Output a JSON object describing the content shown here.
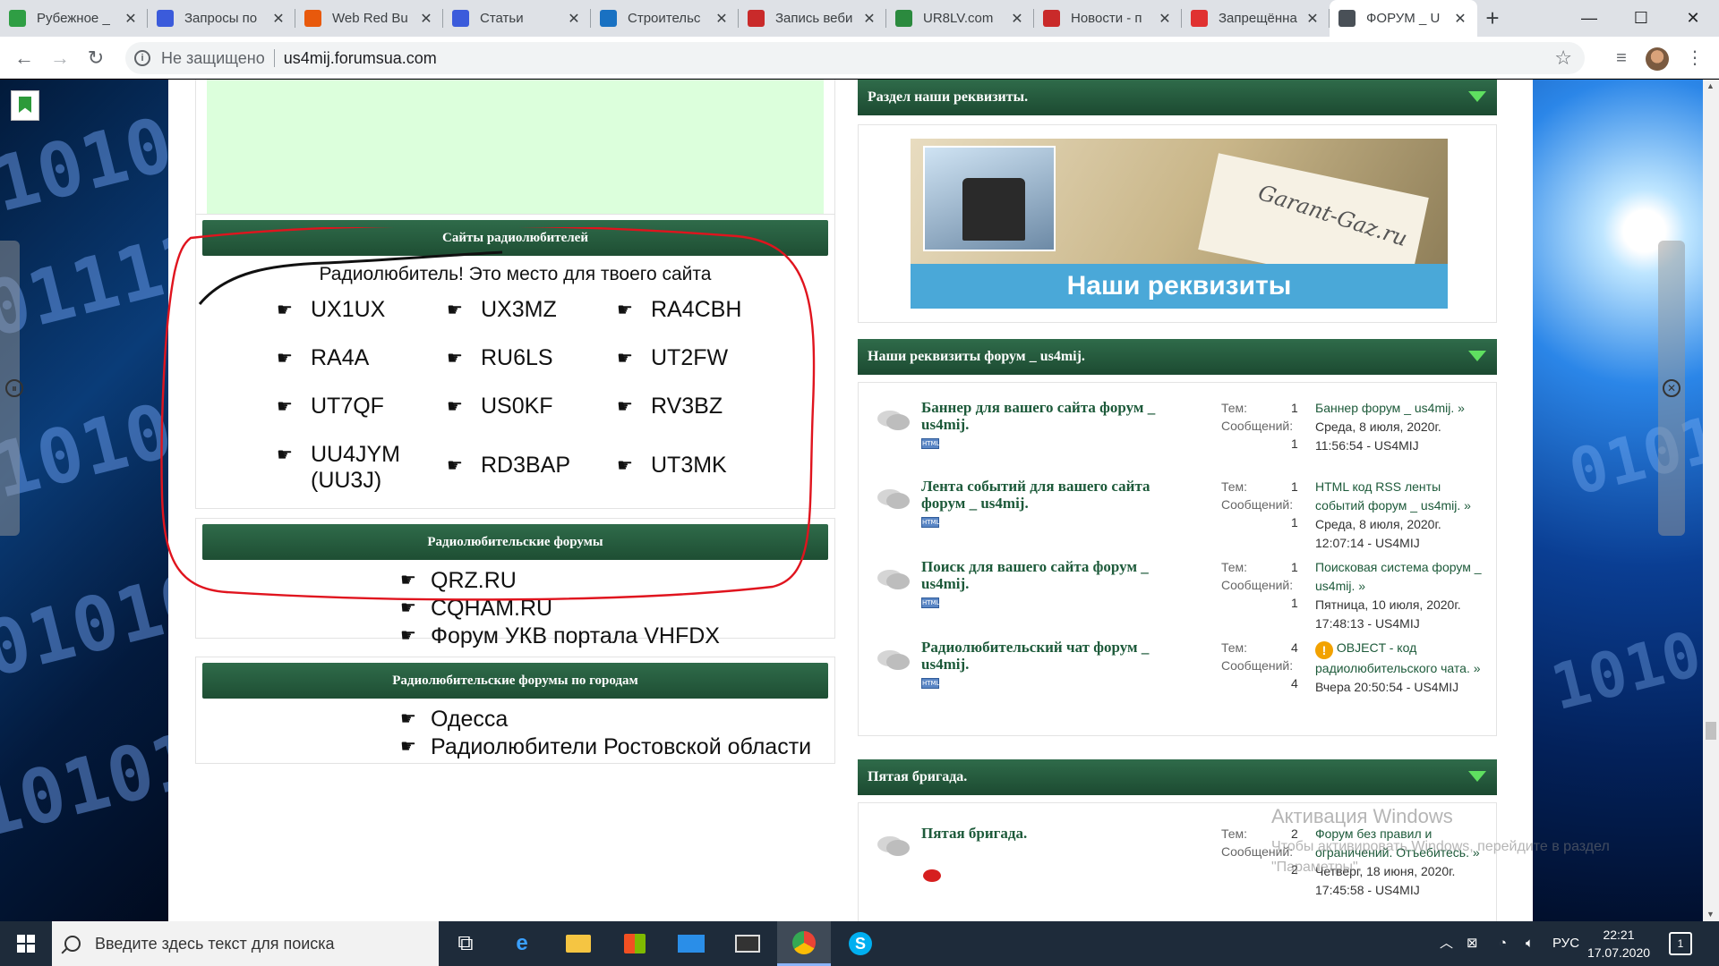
{
  "browser": {
    "tabs": [
      {
        "title": "Рубежное _",
        "favicon": "grid-icon",
        "color": "#2f9e44"
      },
      {
        "title": "Запросы по",
        "favicon": "double-chevron-icon",
        "color": "#3b5bdb"
      },
      {
        "title": "Web Red Bu",
        "favicon": "globe-icon",
        "color": "#e8590c"
      },
      {
        "title": "Статьи",
        "favicon": "double-chevron-icon",
        "color": "#3b5bdb"
      },
      {
        "title": "Строительс",
        "favicon": "swirl-icon",
        "color": "#1971c2"
      },
      {
        "title": "Запись веби",
        "favicon": "round-icon",
        "color": "#c92a2a"
      },
      {
        "title": "UR8LV.com",
        "favicon": "antenna-icon",
        "color": "#2b8a3e"
      },
      {
        "title": "Новости - п",
        "favicon": "k-letter-icon",
        "color": "#c92a2a"
      },
      {
        "title": "Запрещённа",
        "favicon": "youtube-icon",
        "color": "#e03131"
      },
      {
        "title": "ФОРУМ _ U",
        "favicon": "antenna-icon",
        "color": "#495057",
        "active": true
      }
    ],
    "new_tab": "+",
    "controls": {
      "minimize": "—",
      "maximize": "☐",
      "close": "✕"
    },
    "nav": {
      "back": "←",
      "forward": "→",
      "reload": "↻"
    },
    "omnibox": {
      "security": "Не защищено",
      "url": "us4mij.forumsua.com"
    }
  },
  "left": {
    "sites_panel": {
      "title": "Сайты радиолюбителей",
      "subtitle": "Радиолюбитель! Это место для твоего сайта",
      "sites": [
        "UX1UX",
        "UX3MZ",
        "RA4CBH",
        "RA4A",
        "RU6LS",
        "UT2FW",
        "UT7QF",
        "US0KF",
        "RV3BZ",
        "UU4JYM (UU3J)",
        "RD3BAP",
        "UT3MK"
      ]
    },
    "forums_panel": {
      "title": "Радиолюбительские форумы",
      "links": [
        "QRZ.RU",
        "CQHAM.RU",
        "Форум УКВ портала VHFDX"
      ]
    },
    "city_panel": {
      "title": "Радиолюбительские форумы по городам",
      "links": [
        "Одесса",
        "Радиолюбители Ростовской области"
      ]
    }
  },
  "right": {
    "rekv_section": {
      "title": "Раздел наши реквизиты.",
      "banner_script": "Garant-Gaz.ru",
      "banner_text": "Наши реквизиты"
    },
    "forum_section": {
      "title": "Наши реквизиты форум _ us4mij.",
      "stat_topics_label": "Тем:",
      "stat_posts_label": "Сообщений:",
      "rows": [
        {
          "title": "Баннер для вашего сайта форум _ us4mij.",
          "topics": "1",
          "posts": "1",
          "last_link": "Баннер форум _ us4mij. »",
          "last_date": "Среда, 8 июля, 2020г. 11:56:54 - US4MIJ"
        },
        {
          "title": "Лента событий для вашего сайта форум _ us4mij.",
          "topics": "1",
          "posts": "1",
          "last_link": "HTML код RSS ленты событий форум _ us4mij. »",
          "last_date": "Среда, 8 июля, 2020г. 12:07:14 - US4MIJ"
        },
        {
          "title": "Поиск для вашего сайта форум _ us4mij.",
          "topics": "1",
          "posts": "1",
          "last_link": "Поисковая система форум _ us4mij. »",
          "last_date": "Пятница, 10 июля, 2020г. 17:48:13 - US4MIJ"
        },
        {
          "title": "Радиолюбительский чат форум _ us4mij.",
          "topics": "4",
          "posts": "4",
          "last_link": "OBJECT - код радиолюбительского чата. »",
          "last_date": "Вчера 20:50:54 - US4MIJ"
        }
      ]
    },
    "brigade_section": {
      "title": "Пятая бригада.",
      "row": {
        "title": "Пятая бригада.",
        "topics": "2",
        "posts": "2",
        "last_link": "Форум без правил и ограничений. Отъебитесь. »",
        "last_date": "Четверг, 18 июня, 2020г. 17:45:58 - US4MIJ"
      }
    },
    "html_badge": "HTML"
  },
  "watermark": {
    "line1": "Активация Windows",
    "line2": "Чтобы активировать Windows, перейдите в раздел \"Параметры\"."
  },
  "taskbar": {
    "search_placeholder": "Введите здесь текст для поиска",
    "lang": "РУС",
    "time": "22:21",
    "date": "17.07.2020",
    "notifications": "1"
  }
}
